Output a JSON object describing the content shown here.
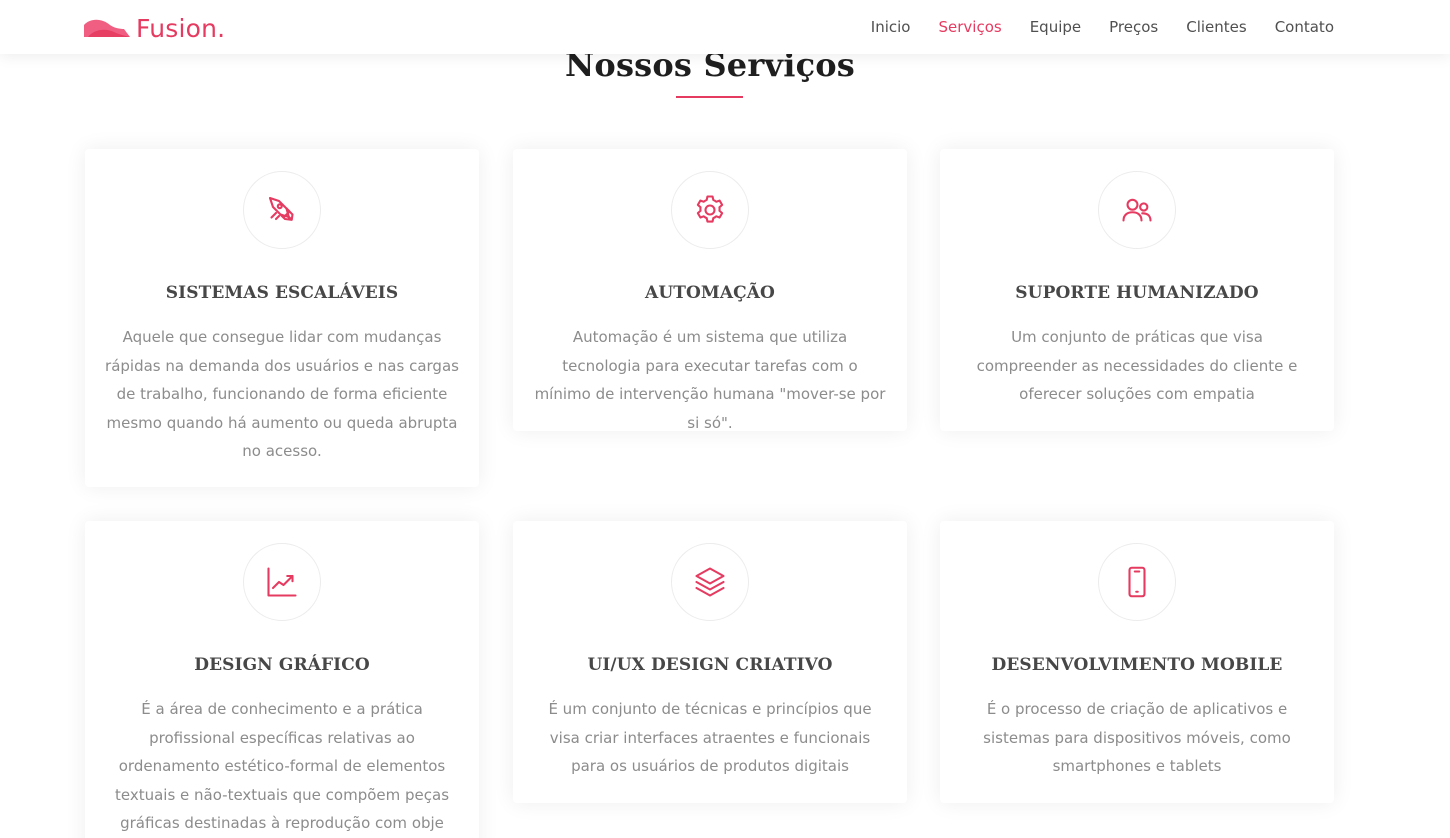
{
  "header": {
    "logo_text": "Fusion.",
    "nav": [
      {
        "label": "Inicio",
        "active": false
      },
      {
        "label": "Serviços",
        "active": true
      },
      {
        "label": "Equipe",
        "active": false
      },
      {
        "label": "Preços",
        "active": false
      },
      {
        "label": "Clientes",
        "active": false
      },
      {
        "label": "Contato",
        "active": false
      }
    ]
  },
  "services": {
    "title": "Nossos Serviços",
    "items": [
      {
        "icon": "rocket-icon",
        "title": "SISTEMAS ESCALÁVEIS",
        "description": "Aquele que consegue lidar com mudanças rápidas na demanda dos usuários e nas cargas de trabalho, funcionando de forma eficiente mesmo quando há aumento ou queda abrupta no acesso."
      },
      {
        "icon": "gear-icon",
        "title": "AUTOMAÇÃO",
        "description": "Automação é um sistema que utiliza tecnologia para executar tarefas com o mínimo de intervenção humana \"mover-se por si só\"."
      },
      {
        "icon": "users-icon",
        "title": "SUPORTE HUMANIZADO",
        "description": "Um conjunto de práticas que visa compreender as necessidades do cliente e oferecer soluções com empatia"
      },
      {
        "icon": "chart-line-icon",
        "title": "DESIGN GRÁFICO",
        "description": "É a área de conhecimento e a prática profissional específicas relativas ao ordenamento estético-formal de elementos textuais e não-textuais que compõem peças gráficas destinadas à reprodução com obje"
      },
      {
        "icon": "layers-icon",
        "title": "UI/UX DESIGN CRIATIVO",
        "description": "É um conjunto de técnicas e princípios que visa criar interfaces atraentes e funcionais para os usuários de produtos digitais"
      },
      {
        "icon": "smartphone-icon",
        "title": "DESENVOLVIMENTO MOBILE",
        "description": "É o processo de criação de aplicativos e sistemas para dispositivos móveis, como smartphones e tablets"
      }
    ]
  },
  "colors": {
    "accent": "#e63b61",
    "title": "#1f1f1f",
    "card_title": "#474747",
    "text": "#8c8c8c"
  }
}
